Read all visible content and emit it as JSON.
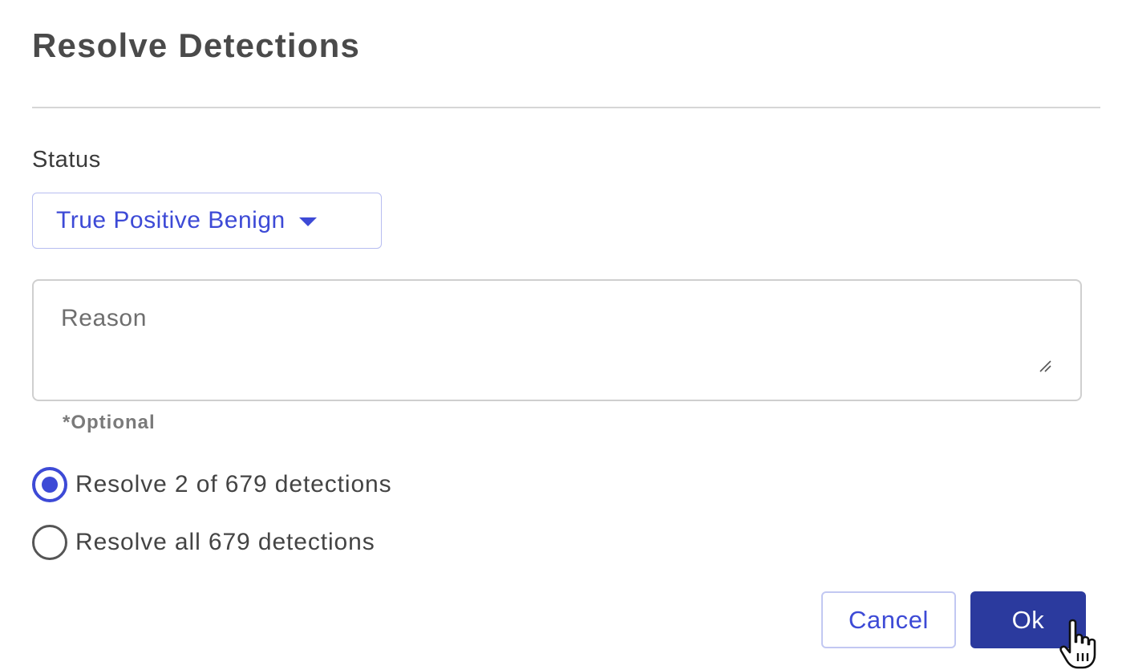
{
  "dialog": {
    "title": "Resolve Detections"
  },
  "status": {
    "label": "Status",
    "selected": "True Positive Benign"
  },
  "reason": {
    "placeholder": "Reason",
    "value": "",
    "hint": "*Optional"
  },
  "scope": {
    "options": [
      {
        "label": "Resolve 2 of 679 detections",
        "checked": true
      },
      {
        "label": "Resolve all 679 detections",
        "checked": false
      }
    ]
  },
  "actions": {
    "cancel_label": "Cancel",
    "ok_label": "Ok"
  },
  "colors": {
    "accent": "#3d4ad6",
    "primary_button": "#2b3a9e"
  },
  "icons": {
    "dropdown": "caret-down-icon",
    "resize": "resize-handle-icon",
    "cursor": "hand-pointer-icon"
  }
}
